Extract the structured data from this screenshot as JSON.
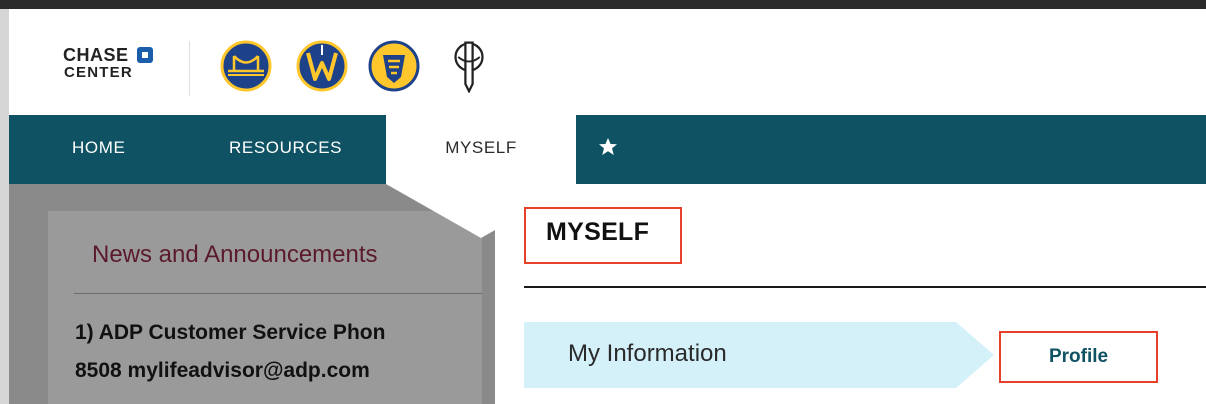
{
  "header": {
    "brand_line1": "CHASE",
    "brand_line2": "CENTER",
    "logos": [
      "warriors-bridge-logo",
      "santa-cruz-warriors-logo",
      "warriors-gaming-logo",
      "golden-guardians-logo"
    ]
  },
  "nav": {
    "items": [
      {
        "label": "HOME"
      },
      {
        "label": "RESOURCES"
      },
      {
        "label": "MYSELF",
        "active": true
      }
    ],
    "favorites_icon": "star-icon",
    "bg_color": "#0e5263"
  },
  "news": {
    "title": "News and Announcements",
    "line1": "1) ADP Customer Service Phon",
    "line2": "8508 mylifeadvisor@adp.com"
  },
  "myself": {
    "title": "MYSELF",
    "row_label": "My Information",
    "row_link": "Profile"
  },
  "colors": {
    "highlight": "#e8412b",
    "info_row_bg": "#d4f1fa",
    "news_title": "#5b1a2c"
  }
}
